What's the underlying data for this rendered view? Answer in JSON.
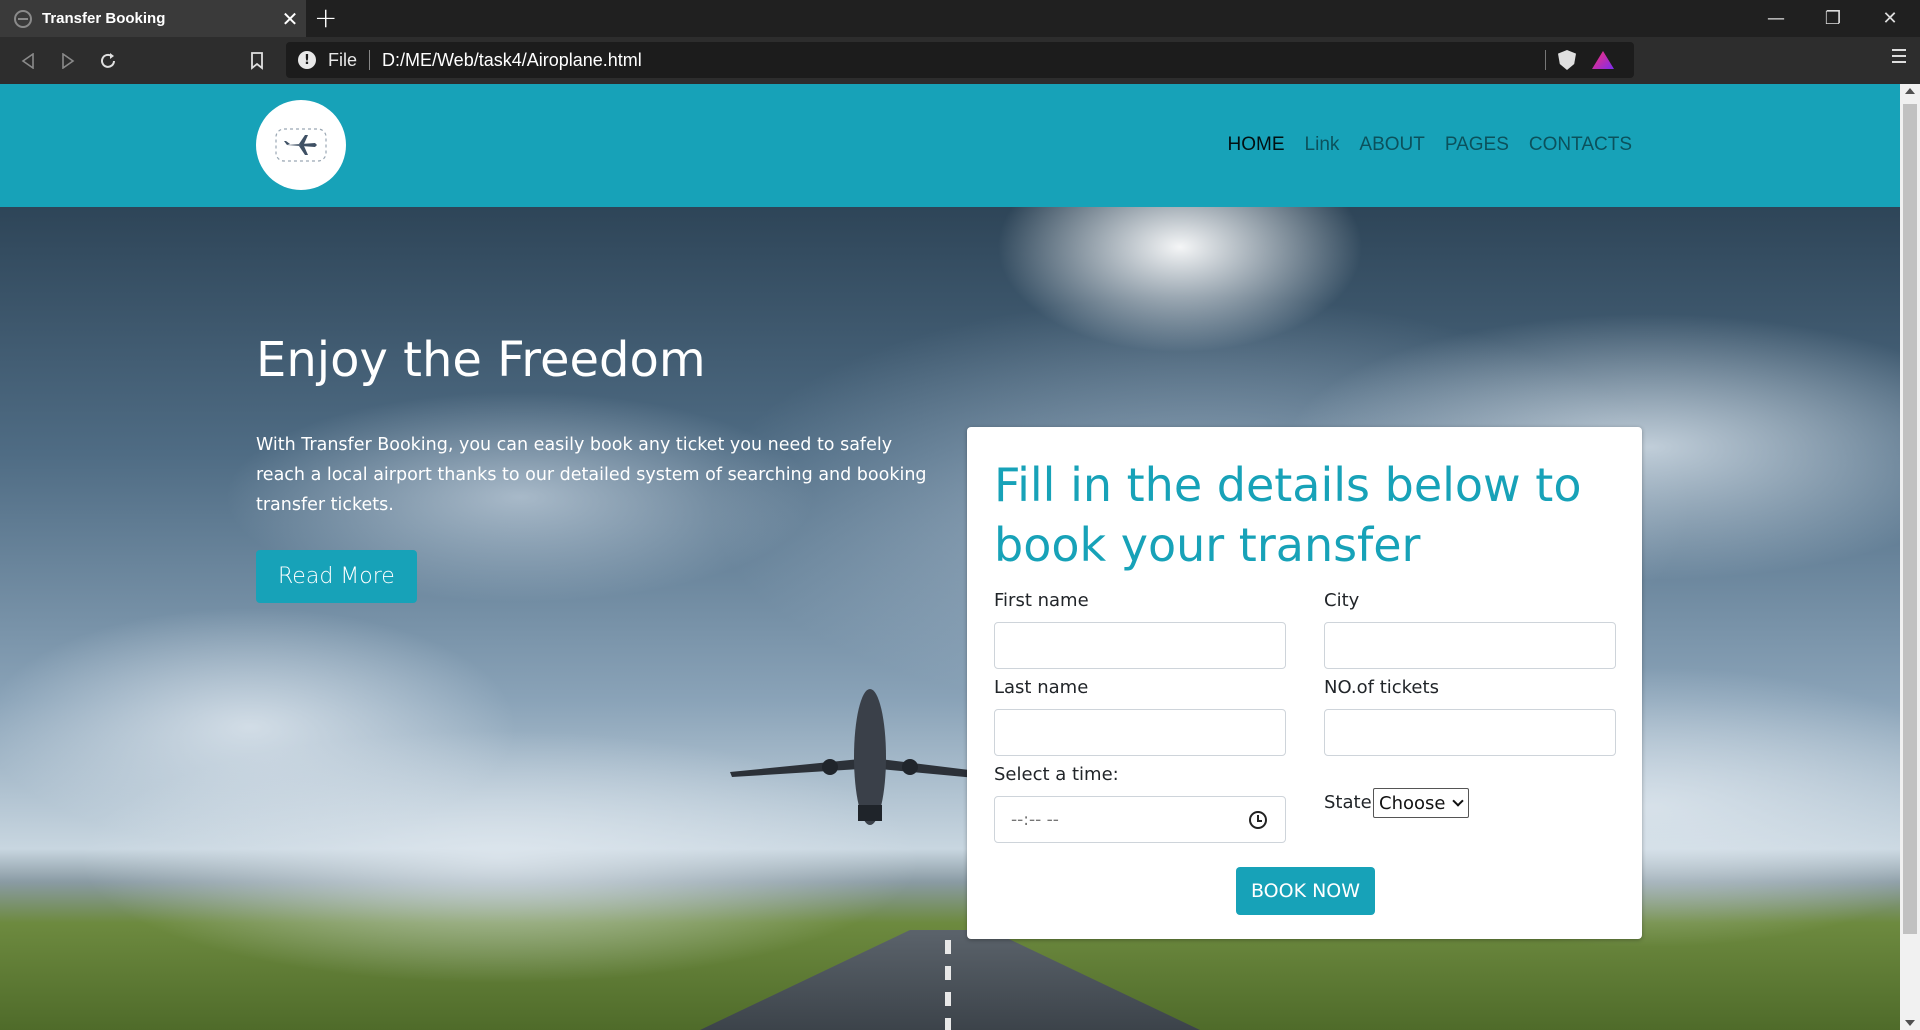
{
  "browser": {
    "tab_title": "Transfer Booking",
    "url_scheme_label": "File",
    "url_path": "D:/ME/Web/task4/Airoplane.html"
  },
  "nav": {
    "items": [
      {
        "label": "HOME",
        "active": true
      },
      {
        "label": "Link",
        "active": false
      },
      {
        "label": "ABOUT",
        "active": false
      },
      {
        "label": "PAGES",
        "active": false
      },
      {
        "label": "CONTACTS",
        "active": false
      }
    ]
  },
  "hero": {
    "title": "Enjoy the Freedom",
    "text": "With Transfer Booking, you can easily book any ticket you need to safely reach a local airport thanks to our detailed system of searching and booking transfer tickets.",
    "button": "Read More"
  },
  "form": {
    "title": "Fill in the details below to book your transfer",
    "first_name_label": "First name",
    "city_label": "City",
    "last_name_label": "Last name",
    "tickets_label": "NO.of tickets",
    "time_label": "Select a time:",
    "time_placeholder": "--:-- --",
    "state_label": "State",
    "state_selected": "Choose",
    "submit": "BOOK NOW"
  },
  "colors": {
    "accent": "#17a2b8"
  }
}
